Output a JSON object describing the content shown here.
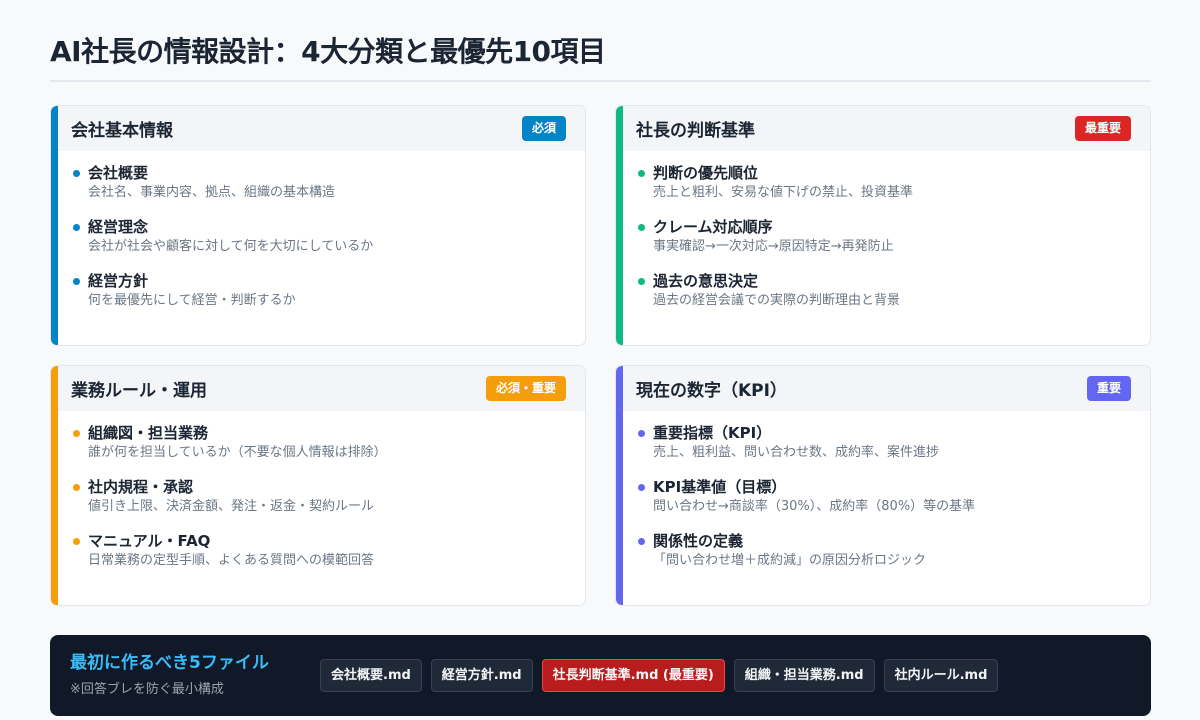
{
  "page_title": "AI社長の情報設計：4大分類と最優先10項目",
  "cards": [
    {
      "title": "会社基本情報",
      "badge": "必須",
      "accent": "#0284c7",
      "badge_color": "#0284c7",
      "items": [
        {
          "label": "会社概要",
          "desc": "会社名、事業内容、拠点、組織の基本構造"
        },
        {
          "label": "経営理念",
          "desc": "会社が社会や顧客に対して何を大切にしているか"
        },
        {
          "label": "経営方針",
          "desc": "何を最優先にして経営・判断するか"
        }
      ]
    },
    {
      "title": "社長の判断基準",
      "badge": "最重要",
      "accent": "#10b981",
      "badge_color": "#dc2626",
      "items": [
        {
          "label": "判断の優先順位",
          "desc": "売上と粗利、安易な値下げの禁止、投資基準"
        },
        {
          "label": "クレーム対応順序",
          "desc": "事実確認→一次対応→原因特定→再発防止"
        },
        {
          "label": "過去の意思決定",
          "desc": "過去の経営会議での実際の判断理由と背景"
        }
      ]
    },
    {
      "title": "業務ルール・運用",
      "badge": "必須・重要",
      "accent": "#f59e0b",
      "badge_color": "#f59e0b",
      "items": [
        {
          "label": "組織図・担当業務",
          "desc": "誰が何を担当しているか（不要な個人情報は排除）"
        },
        {
          "label": "社内規程・承認",
          "desc": "値引き上限、決済金額、発注・返金・契約ルール"
        },
        {
          "label": "マニュアル・FAQ",
          "desc": "日常業務の定型手順、よくある質問への模範回答"
        }
      ]
    },
    {
      "title": "現在の数字（KPI）",
      "badge": "重要",
      "accent": "#6366f1",
      "badge_color": "#6366f1",
      "items": [
        {
          "label": "重要指標（KPI）",
          "desc": "売上、粗利益、問い合わせ数、成約率、案件進捗"
        },
        {
          "label": "KPI基準値（目標）",
          "desc": "問い合わせ→商談率（30%）、成約率（80%）等の基準"
        },
        {
          "label": "関係性の定義",
          "desc": "「問い合わせ増＋成約減」の原因分析ロジック"
        }
      ]
    }
  ],
  "footer": {
    "title": "最初に作るべき5ファイル",
    "note": "※回答ブレを防ぐ最小構成",
    "files": [
      "会社概要.md",
      "経営方針.md",
      "社長判断基準.md (最重要)",
      "組織・担当業務.md",
      "社内ルール.md"
    ]
  }
}
